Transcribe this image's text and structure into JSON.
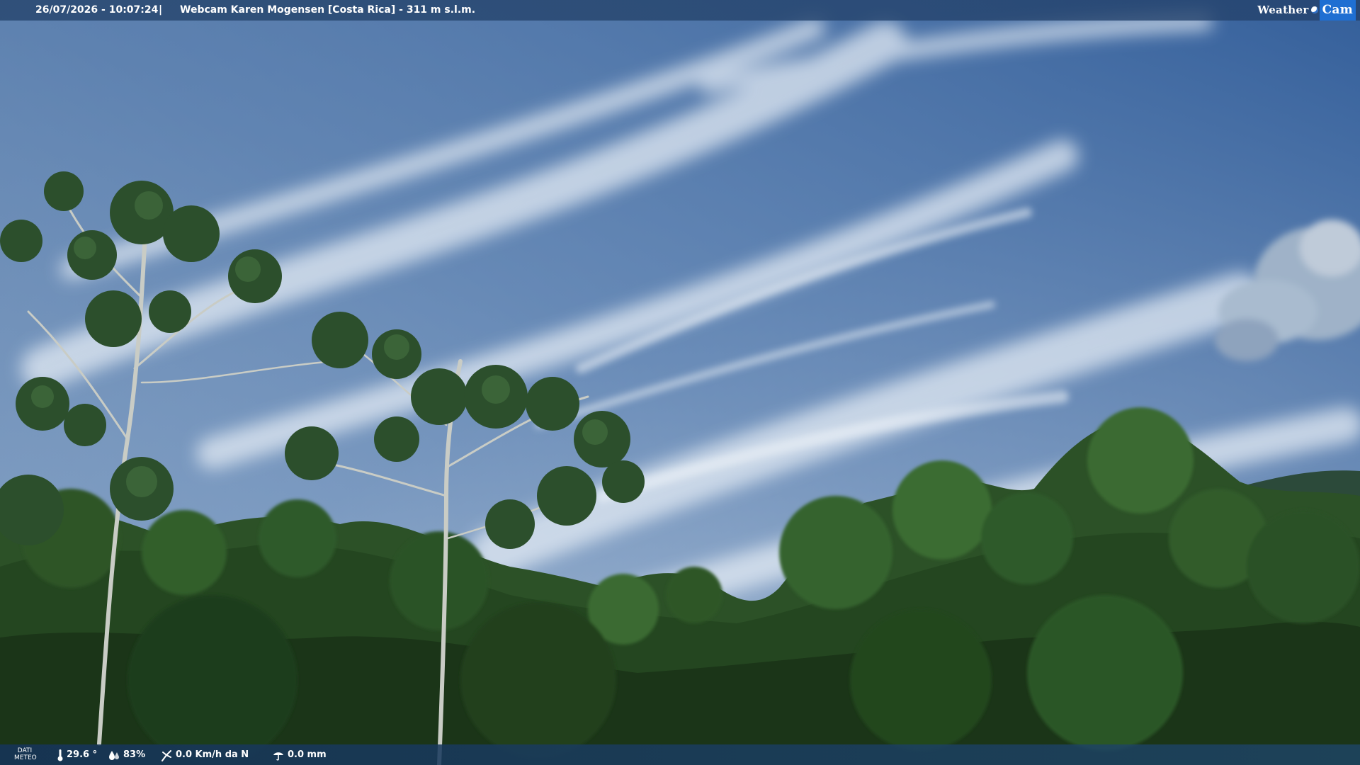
{
  "overlay": {
    "timestamp": "26/07/2026 - 10:07:24",
    "separator": "|",
    "camera_title": "Webcam Karen Mogensen [Costa Rica]  - 311 m s.l.m.",
    "brand_weather": "Weather",
    "brand_cam": "Cam"
  },
  "weather": {
    "label_line1": "DATI",
    "label_line2": "METEO",
    "temperature": "29.6 °",
    "humidity": "83%",
    "wind": "0.0 Km/h da N",
    "rain": "0.0 mm"
  },
  "icons": {
    "temperature": "thermometer-icon",
    "humidity": "humidity-drop-icon",
    "wind": "wind-icon",
    "rain": "rain-gauge-icon"
  },
  "colors": {
    "sky_top": "#3f69a3",
    "sky_bottom": "#c4d3e2",
    "foliage_dark": "#1e3a1c",
    "foliage_mid": "#2f5a28",
    "bar": "#24456c"
  }
}
